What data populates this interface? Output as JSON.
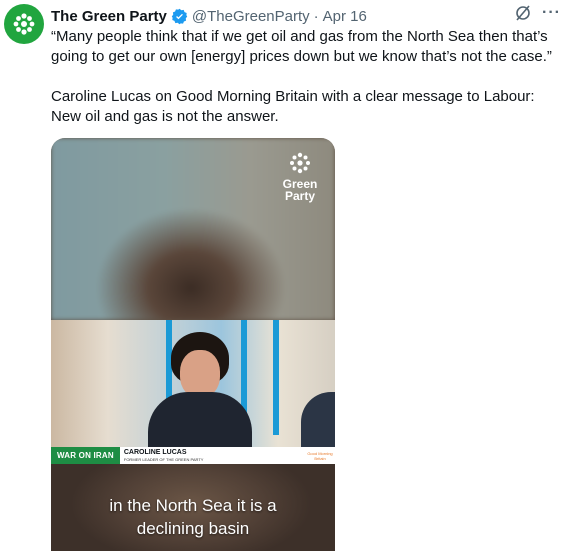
{
  "tweet": {
    "account_name": "The Green Party",
    "handle": "@TheGreenParty",
    "separator": "·",
    "date": "Apr 16",
    "text_paragraph_1": "“Many people think that if we get oil and gas from the North Sea then that’s going to get our own [energy] prices down but we know that’s not the case.”",
    "text_paragraph_2": "Caroline Lucas on Good Morning Britain with a clear message to Labour: New oil and gas is not the answer.",
    "more_label": "···",
    "verified_color": "#1d9bf0",
    "avatar_color": "#21a53f"
  },
  "video": {
    "watermark_line1": "Green",
    "watermark_line2": "Party",
    "ticker_tag": "WAR ON IRAN",
    "ticker_name": "CAROLINE LUCAS",
    "ticker_role": "FORMER LEADER OF THE GREEN PARTY",
    "ticker_logo": "Good Morning Britain",
    "caption_line1": "in the North Sea it is a",
    "caption_line2": "declining basin",
    "ticker_color": "#1e8d44"
  }
}
